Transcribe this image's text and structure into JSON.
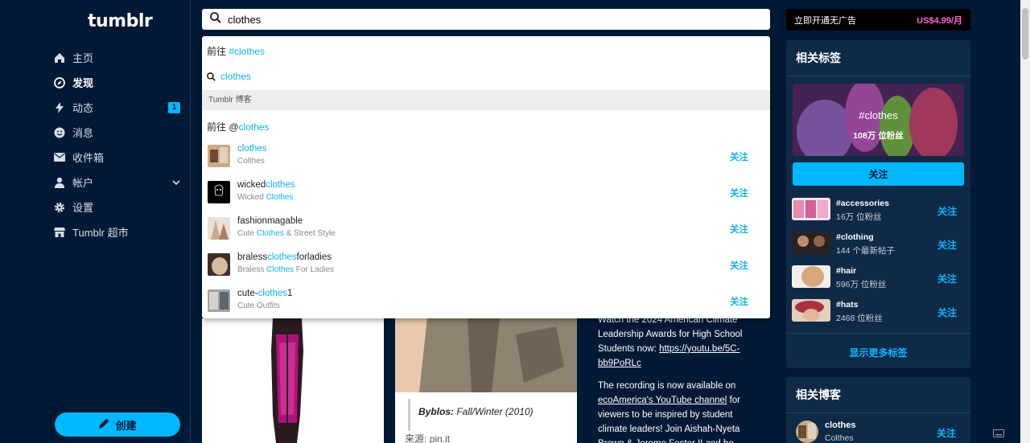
{
  "logo": "tumblr",
  "nav": [
    {
      "label": "主页",
      "icon": "home-icon"
    },
    {
      "label": "发现",
      "icon": "compass-icon",
      "active": true
    },
    {
      "label": "动态",
      "icon": "bolt-icon",
      "badge": "1"
    },
    {
      "label": "消息",
      "icon": "smiley-icon"
    },
    {
      "label": "收件箱",
      "icon": "envelope-icon"
    },
    {
      "label": "帐户",
      "icon": "user-icon"
    },
    {
      "label": "设置",
      "icon": "gear-icon"
    },
    {
      "label": "Tumblr 超市",
      "icon": "store-icon"
    }
  ],
  "create_label": "创建",
  "search": {
    "value": "clothes"
  },
  "dropdown": {
    "go_tag_prefix": "前往 ",
    "go_tag": "#clothes",
    "query": "clothes",
    "section_label": "Tumblr 博客",
    "go_blog_prefix": "前往 @",
    "go_blog": "clothes",
    "follow_label": "关注",
    "blogs": [
      {
        "pre": "",
        "hl": "clothes",
        "post": "",
        "sub_pre": "Colthes",
        "sub_hl": "",
        "sub_post": ""
      },
      {
        "pre": "wicked",
        "hl": "clothes",
        "post": "",
        "sub_pre": "Wicked ",
        "sub_hl": "Clothes",
        "sub_post": ""
      },
      {
        "pre": "fashionmagable",
        "hl": "",
        "post": "",
        "sub_pre": "Cute ",
        "sub_hl": "Clothes",
        "sub_post": " & Street Style"
      },
      {
        "pre": "braless",
        "hl": "clothes",
        "post": "forladies",
        "sub_pre": "Braless ",
        "sub_hl": "Clothes",
        "sub_post": " For Ladies"
      },
      {
        "pre": "cute-",
        "hl": "clothes",
        "post": "1",
        "sub_pre": "Cute Outfits",
        "sub_hl": "",
        "sub_post": ""
      }
    ]
  },
  "posts": {
    "caption_brand": "Byblos:",
    "caption_rest": " Fall/Winter (2010)",
    "source_label": "来源:",
    "source_value": "pin.it",
    "text_line1": "Watch the 2024 American Climate Leadership Awards for High School Students now: ",
    "text_link1": "https://youtu.be/5C-bb9PoRLc",
    "text_line2a": "The recording is now available on ",
    "text_link2": "ecoAmerica's YouTube channel",
    "text_line2b": " for viewers to be inspired by student climate leaders! Join Aishah-Nyeta Brown & Jerome Foster II and be"
  },
  "promo": {
    "label": "立即开通无广告",
    "price": "US$4.99/月"
  },
  "related_tags": {
    "title": "相关标签",
    "hero_tag": "#clothes",
    "hero_count": "108万 位粉丝",
    "follow_label": "关注",
    "tags": [
      {
        "name": "#accessories",
        "count": "16万 位粉丝"
      },
      {
        "name": "#clothing",
        "count": "144 个最新帖子"
      },
      {
        "name": "#hair",
        "count": "596万 位粉丝"
      },
      {
        "name": "#hats",
        "count": "2468 位粉丝"
      }
    ],
    "more": "显示更多标签"
  },
  "related_blogs": {
    "title": "相关博客",
    "name": "clothes",
    "sub": "Colthes",
    "follow_label": "关注"
  }
}
